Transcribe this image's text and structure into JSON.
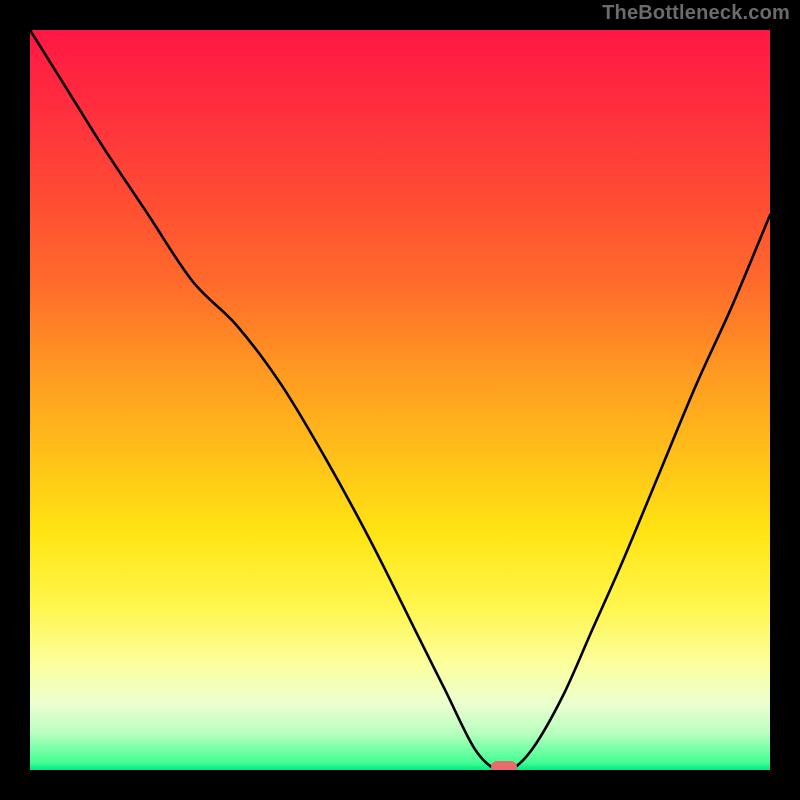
{
  "watermark": "TheBottleneck.com",
  "colors": {
    "frame": "#000000",
    "curve": "#000000",
    "marker": "#e86a6a",
    "watermark_text": "#6b6b6b"
  },
  "chart_data": {
    "type": "line",
    "title": "",
    "xlabel": "",
    "ylabel": "",
    "x_range": [
      0,
      100
    ],
    "y_range": [
      0,
      100
    ],
    "background_gradient_stops": [
      {
        "pos": 0,
        "color": "#ff1744"
      },
      {
        "pos": 10,
        "color": "#ff2d3f"
      },
      {
        "pos": 22,
        "color": "#ff4a34"
      },
      {
        "pos": 34,
        "color": "#ff6a2b"
      },
      {
        "pos": 46,
        "color": "#ff9822"
      },
      {
        "pos": 58,
        "color": "#ffc218"
      },
      {
        "pos": 68,
        "color": "#ffe413"
      },
      {
        "pos": 78,
        "color": "#fff64d"
      },
      {
        "pos": 86,
        "color": "#fbffa0"
      },
      {
        "pos": 91,
        "color": "#ecffcf"
      },
      {
        "pos": 95,
        "color": "#b8ffbf"
      },
      {
        "pos": 99,
        "color": "#43ff93"
      },
      {
        "pos": 100,
        "color": "#00e886"
      }
    ],
    "series": [
      {
        "name": "bottleneck-curve",
        "x": [
          0,
          5,
          10,
          16,
          22,
          28,
          34,
          40,
          46,
          52,
          56,
          60,
          63,
          65,
          68,
          72,
          76,
          80,
          85,
          90,
          95,
          100
        ],
        "values": [
          100,
          92,
          84,
          75,
          66,
          60,
          52,
          42,
          31,
          19,
          11,
          3,
          0,
          0,
          3,
          10,
          19,
          28,
          40,
          52,
          63,
          75
        ]
      }
    ],
    "marker": {
      "x": 64,
      "y": 0
    }
  }
}
